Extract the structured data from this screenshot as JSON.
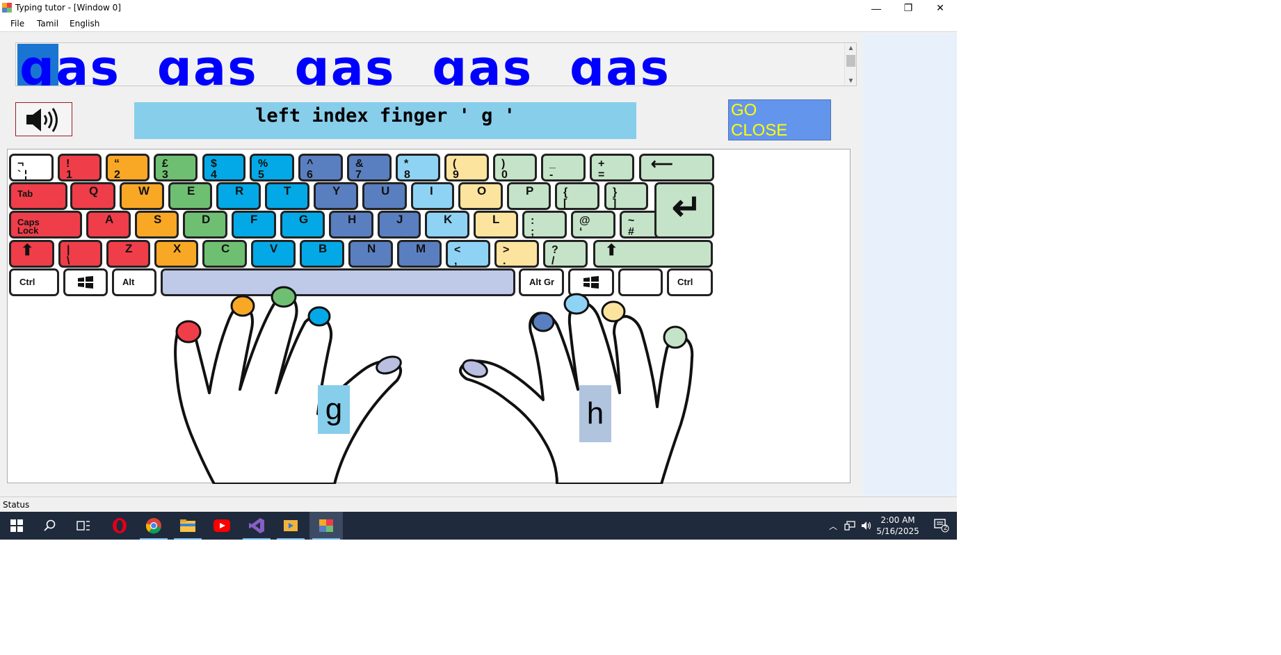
{
  "window": {
    "title": "Typing tutor - [Window 0]",
    "minimize": "—",
    "restore": "❐",
    "close": "✕"
  },
  "menu": {
    "items": [
      "File",
      "Tamil",
      "English"
    ]
  },
  "practice": {
    "text": "gas  gas  gas  gas  gas"
  },
  "hint": {
    "text": "left index finger ' g '"
  },
  "go_close": {
    "line1": "GO",
    "line2": "CLOSE"
  },
  "keyboard": {
    "colors": {
      "red": "#ef3e4a",
      "orange": "#f9a825",
      "green": "#6fbf73",
      "cyan": "#03a9e6",
      "blue": "#5a7fc0",
      "lightblue": "#8fd3f4",
      "yellow": "#fde49e",
      "pale": "#c5e3c8",
      "white": "#ffffff",
      "space": "#bfc9e8"
    },
    "row1": [
      {
        "top": "¬",
        "bottom": "` ¦",
        "color": "white"
      },
      {
        "top": "!",
        "bottom": "1",
        "color": "red"
      },
      {
        "top": "“",
        "bottom": "2",
        "color": "orange"
      },
      {
        "top": "£",
        "bottom": "3",
        "color": "green"
      },
      {
        "top": "$",
        "bottom": "4",
        "color": "cyan"
      },
      {
        "top": "%",
        "bottom": "5",
        "color": "cyan"
      },
      {
        "top": "^",
        "bottom": "6",
        "color": "blue"
      },
      {
        "top": "&",
        "bottom": "7",
        "color": "blue"
      },
      {
        "top": "*",
        "bottom": "8",
        "color": "lightblue"
      },
      {
        "top": "(",
        "bottom": "9",
        "color": "yellow"
      },
      {
        "top": ")",
        "bottom": "0",
        "color": "pale"
      },
      {
        "top": "_",
        "bottom": "-",
        "color": "pale"
      },
      {
        "top": "+",
        "bottom": "=",
        "color": "pale"
      },
      {
        "top": "⟵",
        "bottom": "",
        "color": "pale"
      }
    ],
    "row2": [
      {
        "top": "Tab",
        "bottom": "",
        "color": "red"
      },
      {
        "top": "Q",
        "bottom": "",
        "color": "red"
      },
      {
        "top": "W",
        "bottom": "",
        "color": "orange"
      },
      {
        "top": "E",
        "bottom": "",
        "color": "green"
      },
      {
        "top": "R",
        "bottom": "",
        "color": "cyan"
      },
      {
        "top": "T",
        "bottom": "",
        "color": "cyan"
      },
      {
        "top": "Y",
        "bottom": "",
        "color": "blue"
      },
      {
        "top": "U",
        "bottom": "",
        "color": "blue"
      },
      {
        "top": "I",
        "bottom": "",
        "color": "lightblue"
      },
      {
        "top": "O",
        "bottom": "",
        "color": "yellow"
      },
      {
        "top": "P",
        "bottom": "",
        "color": "pale"
      },
      {
        "top": "{",
        "bottom": "[",
        "color": "pale"
      },
      {
        "top": "}",
        "bottom": "]",
        "color": "pale"
      }
    ],
    "row3": [
      {
        "top": "Caps",
        "bottom": "Lock",
        "color": "red"
      },
      {
        "top": "A",
        "bottom": "",
        "color": "red"
      },
      {
        "top": "S",
        "bottom": "",
        "color": "orange"
      },
      {
        "top": "D",
        "bottom": "",
        "color": "green"
      },
      {
        "top": "F",
        "bottom": "",
        "color": "cyan"
      },
      {
        "top": "G",
        "bottom": "",
        "color": "cyan"
      },
      {
        "top": "H",
        "bottom": "",
        "color": "blue"
      },
      {
        "top": "J",
        "bottom": "",
        "color": "blue"
      },
      {
        "top": "K",
        "bottom": "",
        "color": "lightblue"
      },
      {
        "top": "L",
        "bottom": "",
        "color": "yellow"
      },
      {
        "top": ":",
        "bottom": ";",
        "color": "pale"
      },
      {
        "top": "@",
        "bottom": "‘",
        "color": "pale"
      },
      {
        "top": "~",
        "bottom": "#",
        "color": "pale"
      }
    ],
    "row4": [
      {
        "top": "⬆",
        "bottom": "",
        "color": "red"
      },
      {
        "top": "|",
        "bottom": "\\",
        "color": "red"
      },
      {
        "top": "Z",
        "bottom": "",
        "color": "red"
      },
      {
        "top": "X",
        "bottom": "",
        "color": "orange"
      },
      {
        "top": "C",
        "bottom": "",
        "color": "green"
      },
      {
        "top": "V",
        "bottom": "",
        "color": "cyan"
      },
      {
        "top": "B",
        "bottom": "",
        "color": "cyan"
      },
      {
        "top": "N",
        "bottom": "",
        "color": "blue"
      },
      {
        "top": "M",
        "bottom": "",
        "color": "blue"
      },
      {
        "top": "<",
        "bottom": ",",
        "color": "lightblue"
      },
      {
        "top": ">",
        "bottom": ".",
        "color": "yellow"
      },
      {
        "top": "?",
        "bottom": "/",
        "color": "pale"
      },
      {
        "top": "⬆",
        "bottom": "",
        "color": "pale"
      }
    ],
    "row5": [
      {
        "top": "Ctrl",
        "bottom": "",
        "color": "white"
      },
      {
        "top": "win-icon",
        "bottom": "",
        "color": "white"
      },
      {
        "top": "Alt",
        "bottom": "",
        "color": "white"
      },
      {
        "top": "",
        "bottom": "",
        "color": "space"
      },
      {
        "top": "Alt Gr",
        "bottom": "",
        "color": "white"
      },
      {
        "top": "win-icon",
        "bottom": "",
        "color": "white"
      },
      {
        "top": "",
        "bottom": "",
        "color": "white"
      },
      {
        "top": "Ctrl",
        "bottom": "",
        "color": "white"
      }
    ],
    "enter_symbol": "↵"
  },
  "fingers": {
    "left_letter": "g",
    "right_letter": "h"
  },
  "status": {
    "text": "Status"
  },
  "taskbar": {
    "icons": [
      "start-icon",
      "search-icon",
      "task-view-icon",
      "opera-icon",
      "chrome-icon",
      "file-explorer-icon",
      "youtube-icon",
      "visual-studio-icon",
      "media-player-icon",
      "typing-tutor-icon"
    ],
    "time": "2:00 AM",
    "date": "5/16/2025",
    "notifications": "2"
  }
}
